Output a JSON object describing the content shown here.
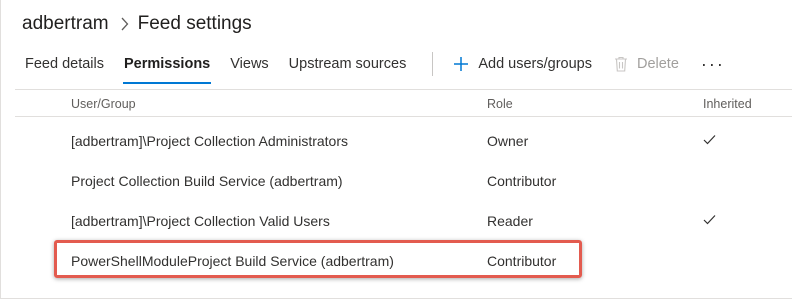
{
  "breadcrumb": {
    "project": "adbertram",
    "separator_icon": "chevron-right-icon",
    "page": "Feed settings"
  },
  "tabs": [
    {
      "label": "Feed details",
      "selected": false
    },
    {
      "label": "Permissions",
      "selected": true
    },
    {
      "label": "Views",
      "selected": false
    },
    {
      "label": "Upstream sources",
      "selected": false
    }
  ],
  "commands": {
    "add_label": "Add users/groups",
    "add_icon": "plus-icon",
    "delete_label": "Delete",
    "delete_icon": "trash-icon",
    "delete_disabled": true,
    "more_label": "···"
  },
  "table": {
    "columns": [
      "User/Group",
      "Role",
      "Inherited"
    ],
    "rows": [
      {
        "user": "[adbertram]\\Project Collection Administrators",
        "role": "Owner",
        "inherited": true
      },
      {
        "user": "Project Collection Build Service (adbertram)",
        "role": "Contributor",
        "inherited": false
      },
      {
        "user": "[adbertram]\\Project Collection Valid Users",
        "role": "Reader",
        "inherited": true
      },
      {
        "user": "PowerShellModuleProject Build Service (adbertram)",
        "role": "Contributor",
        "inherited": false
      }
    ],
    "highlighted_row": 3
  },
  "colors": {
    "accent": "#0078d4",
    "highlight_border": "#e35b4f"
  }
}
